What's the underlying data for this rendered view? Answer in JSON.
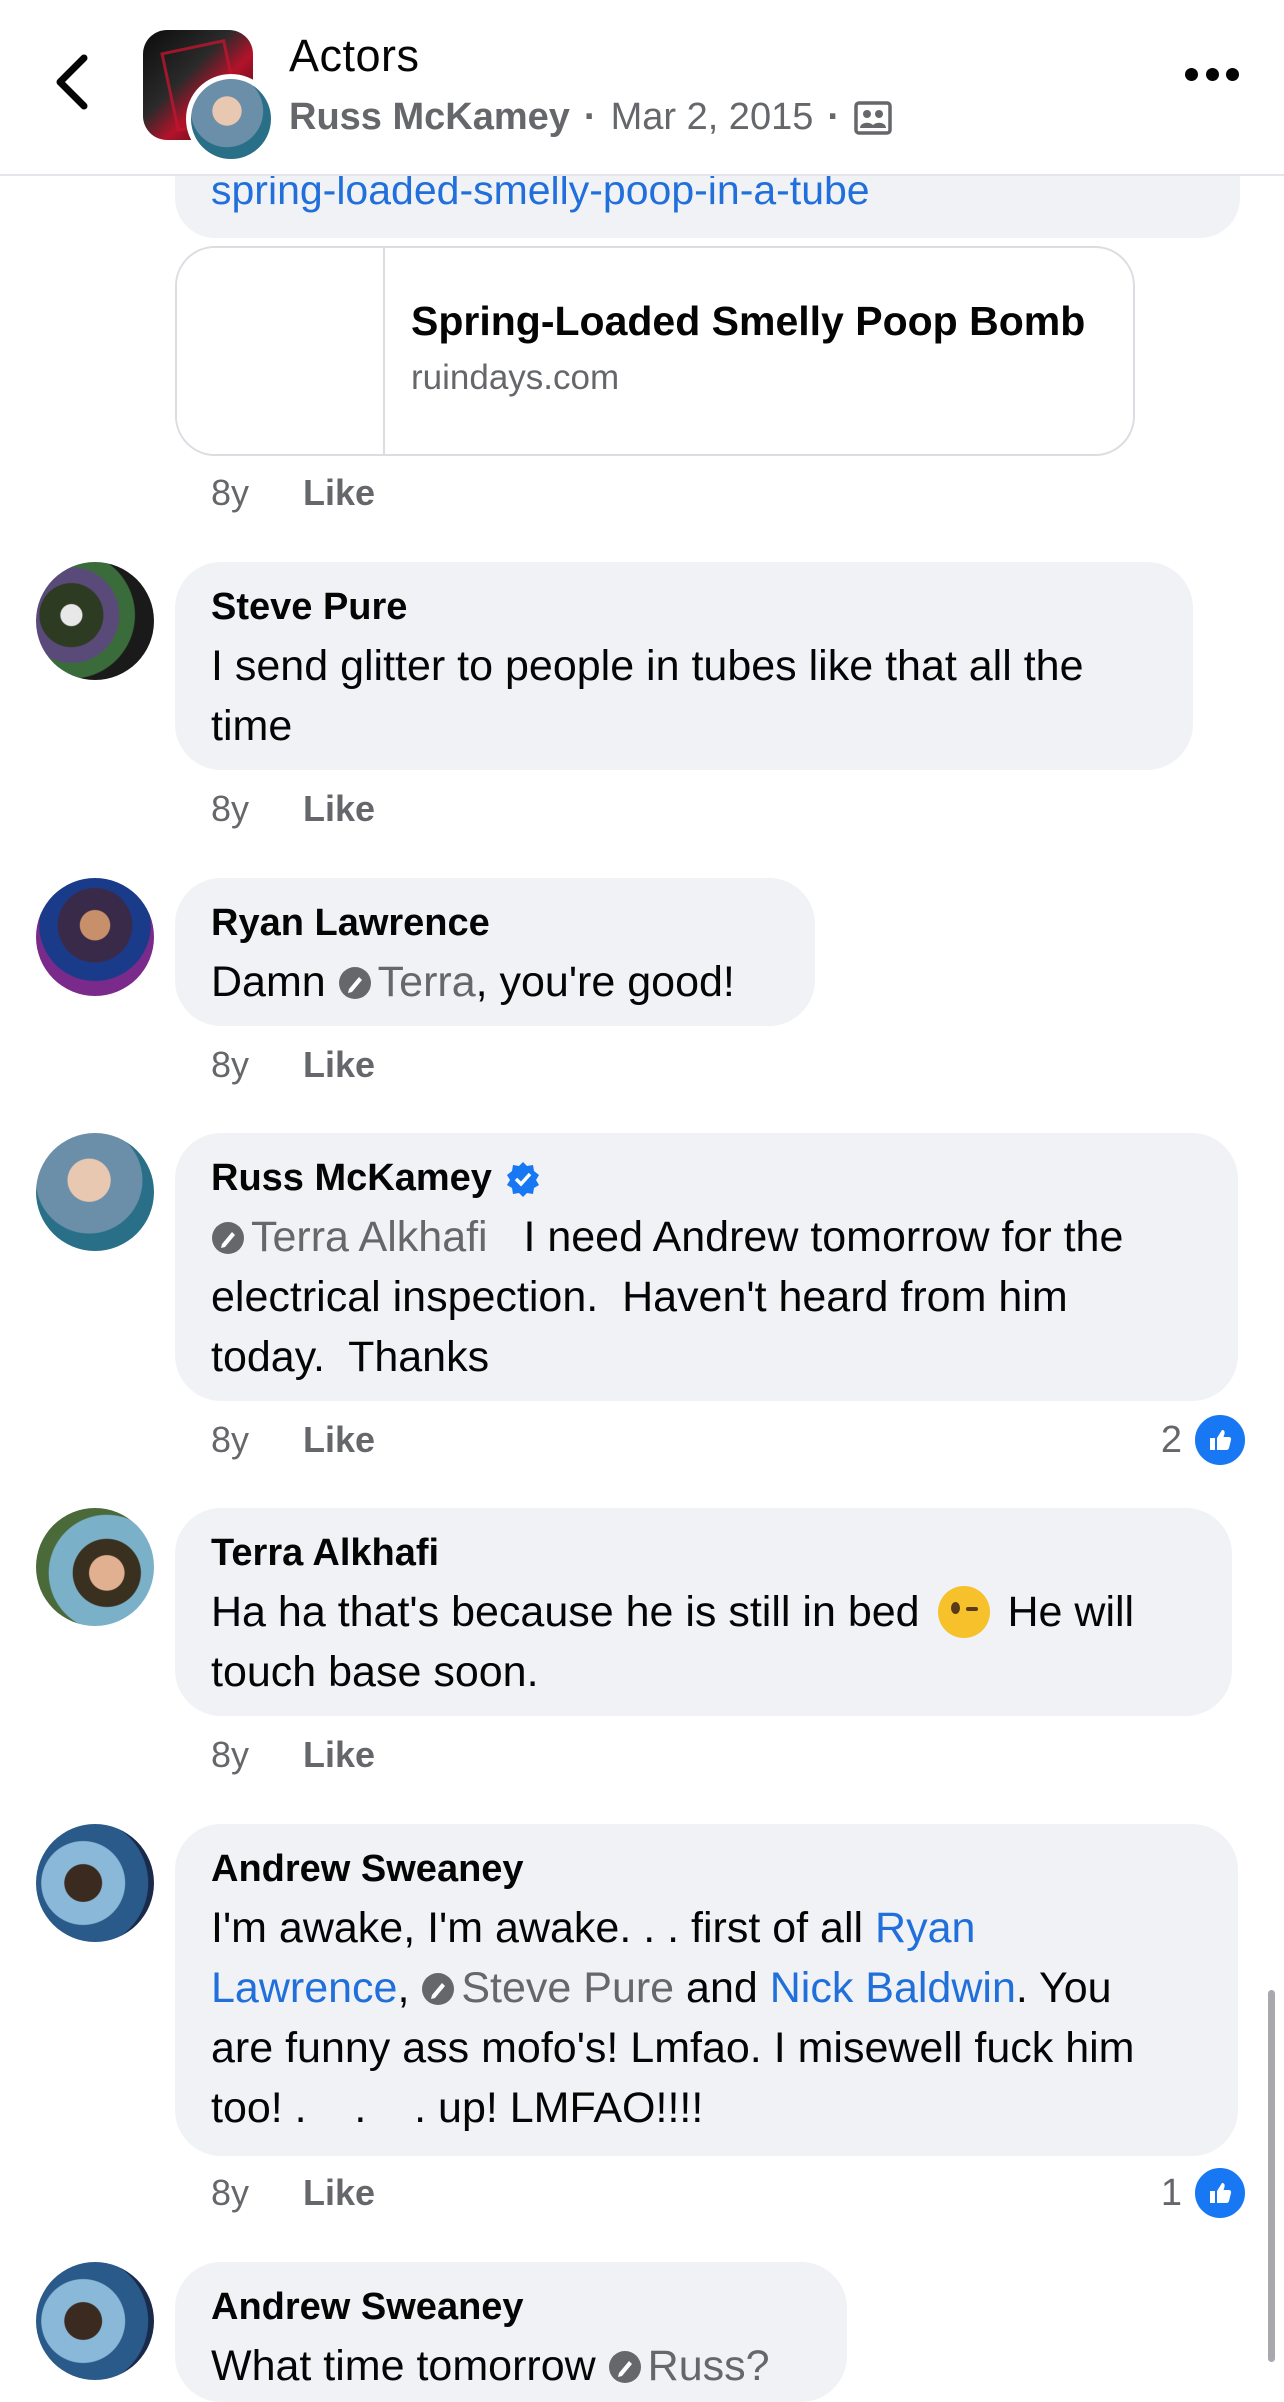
{
  "header": {
    "title": "Actors",
    "author": "Russ McKamey",
    "date": "Mar 2, 2015",
    "separator": "·",
    "back_icon": "chevron-left-icon",
    "privacy_icon": "group-members-icon",
    "more_icon": "more-dots-icon"
  },
  "link_comment": {
    "link_text": "spring-loaded-smelly-poop-in-a-tube",
    "preview_title": "Spring-Loaded Smelly Poop Bomb",
    "preview_domain": "ruindays.com",
    "time": "8y",
    "like": "Like"
  },
  "comments": [
    {
      "name": "Steve Pure",
      "text_line1": "I send glitter to people in tubes like that all the",
      "text_line2": "time",
      "time": "8y",
      "like": "Like"
    },
    {
      "name": "Ryan Lawrence",
      "text_before": "Damn ",
      "mention": "Terra",
      "text_after": ", you're good!",
      "time": "8y",
      "like": "Like"
    },
    {
      "name": "Russ McKamey",
      "verified_icon": "verified-badge-icon",
      "mention": "Terra Alkhafi",
      "text_line1": "I need Andrew tomorrow for the",
      "text_line2": "electrical inspection.  Haven't heard from him",
      "text_line3": "today.  Thanks",
      "time": "8y",
      "like": "Like",
      "reaction_count": "2"
    },
    {
      "name": "Terra Alkhafi",
      "text_line1a": "Ha ha that's because he is still in bed",
      "emoji": "winking-face-emoji",
      "text_line1b": "He will",
      "text_line2": "touch base soon.",
      "time": "8y",
      "like": "Like"
    },
    {
      "name": "Andrew Sweaney",
      "text_line1": "I'm awake, I'm awake. . . first of all ",
      "link1a": "Ryan",
      "link1b": "Lawrence",
      "comma": ", ",
      "mention": "Steve Pure",
      "and": " and ",
      "link2": "Nick Baldwin",
      "you": ". You",
      "text_line3": "are funny ass mofo's! Lmfao. I misewell fuck him",
      "text_line4": "too! .    .    . up! LMFAO!!!!",
      "time": "8y",
      "like": "Like",
      "reaction_count": "1"
    },
    {
      "name": "Andrew Sweaney",
      "text_partial": "What time tomorrow",
      "mention_partial": "Russ?"
    }
  ],
  "colors": {
    "link": "#216fdb",
    "bubble": "#f0f2f5",
    "secondary_text": "#65676b",
    "like_badge": "#1877f2"
  }
}
